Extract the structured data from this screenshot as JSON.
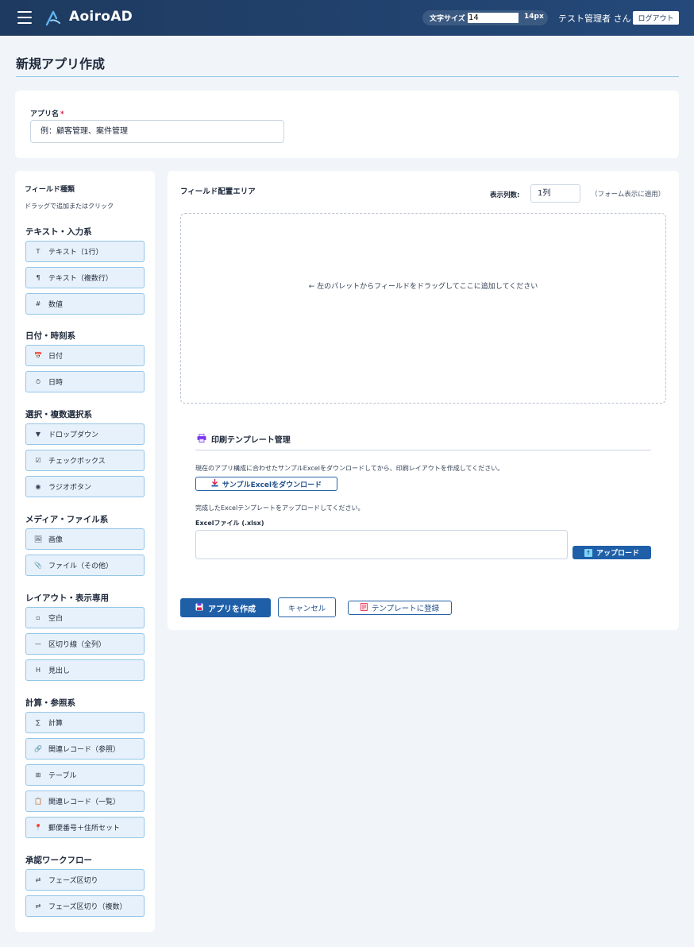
{
  "header": {
    "brand": "AoiroAD",
    "font_size_label": "文字サイズ",
    "font_size_input": "14",
    "font_size_value": "14px",
    "user": "テスト管理者 さん",
    "logout": "ログアウト"
  },
  "page": {
    "title": "新規アプリ作成"
  },
  "app_name": {
    "label": "アプリ名",
    "required_mark": "*",
    "placeholder": "例：顧客管理、案件管理"
  },
  "palette": {
    "title": "フィールド種類",
    "hint": "ドラッグで追加またはクリック",
    "groups": [
      {
        "title": "テキスト・入力系",
        "items": [
          {
            "icon": "T",
            "label": "テキスト（1行）"
          },
          {
            "icon": "¶",
            "label": "テキスト（複数行）"
          },
          {
            "icon": "#",
            "label": "数値"
          }
        ]
      },
      {
        "title": "日付・時刻系",
        "items": [
          {
            "icon": "📅",
            "label": "日付"
          },
          {
            "icon": "⏱",
            "label": "日時"
          }
        ]
      },
      {
        "title": "選択・複数選択系",
        "items": [
          {
            "icon": "▼",
            "label": "ドロップダウン"
          },
          {
            "icon": "☑",
            "label": "チェックボックス"
          },
          {
            "icon": "◉",
            "label": "ラジオボタン"
          }
        ]
      },
      {
        "title": "メディア・ファイル系",
        "items": [
          {
            "icon": "🖼",
            "label": "画像"
          },
          {
            "icon": "📎",
            "label": "ファイル（その他）"
          }
        ]
      },
      {
        "title": "レイアウト・表示専用",
        "items": [
          {
            "icon": "▫",
            "label": "空白"
          },
          {
            "icon": "—",
            "label": "区切り線（全列）"
          },
          {
            "icon": "H",
            "label": "見出し"
          }
        ]
      },
      {
        "title": "計算・参照系",
        "items": [
          {
            "icon": "∑",
            "label": "計算"
          },
          {
            "icon": "🔗",
            "label": "関連レコード（参照）"
          },
          {
            "icon": "⊞",
            "label": "テーブル"
          },
          {
            "icon": "📋",
            "label": "関連レコード（一覧）"
          },
          {
            "icon": "📍",
            "label": "郵便番号＋住所セット"
          }
        ]
      },
      {
        "title": "承認ワークフロー",
        "items": [
          {
            "icon": "⇄",
            "label": "フェーズ区切り"
          },
          {
            "icon": "⇄",
            "label": "フェーズ区切り（複数）"
          }
        ]
      }
    ]
  },
  "field_area": {
    "title": "フィールド配置エリア",
    "columns_label": "表示列数:",
    "columns_value": "1列",
    "columns_note": "（フォーム表示に適用）",
    "drop_hint": "← 左のパレットからフィールドをドラッグしてここに追加してください"
  },
  "print_template": {
    "title": "印刷テンプレート管理",
    "desc_download": "現在のアプリ構成に合わせたサンプルExcelをダウンロードしてから、印刷レイアウトを作成してください。",
    "download_button": "サンプルExcelをダウンロード",
    "desc_upload": "完成したExcelテンプレートをアップロードしてください。",
    "file_label": "Excelファイル (.xlsx)",
    "upload_button": "アップロード"
  },
  "actions": {
    "create": "アプリを作成",
    "cancel": "キャンセル",
    "register_template": "テンプレートに登録"
  },
  "colors": {
    "header_bg": "#1e3a5f",
    "primary": "#1e5fa8",
    "palette_item_bg": "#e7f1fb",
    "palette_item_border": "#93c5e8",
    "required": "#e11d48"
  }
}
